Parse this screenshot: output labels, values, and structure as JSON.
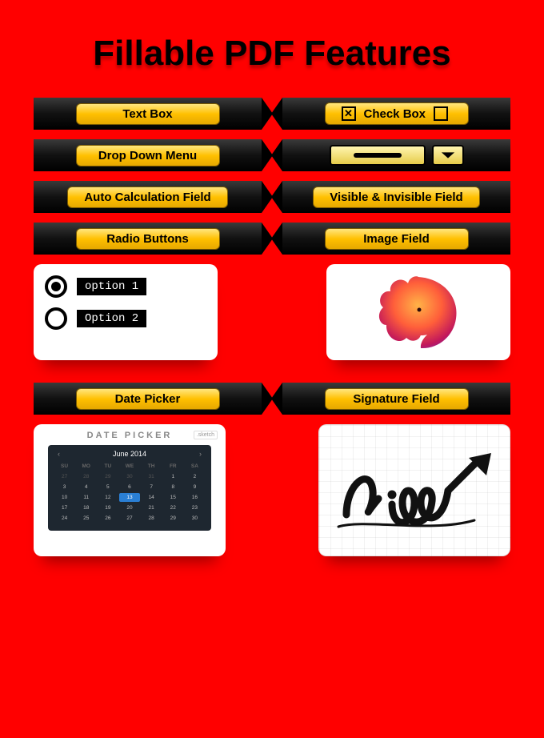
{
  "title": "Fillable PDF Features",
  "features": {
    "text_box": "Text Box",
    "check_box": "Check Box",
    "drop_down": "Drop Down Menu",
    "auto_calc": "Auto Calculation Field",
    "vis_invis": "Visible & Invisible Field",
    "radio": "Radio Buttons",
    "image_field": "Image Field",
    "date_picker": "Date Picker",
    "signature": "Signature Field"
  },
  "radio_options": {
    "opt1": "option 1",
    "opt2": "Option 2"
  },
  "datepicker": {
    "brand": "DATE PICKER",
    "badge": ".sketch",
    "month": "June 2014",
    "headers": [
      "SU",
      "MO",
      "TU",
      "WE",
      "TH",
      "FR",
      "SA"
    ],
    "grid": [
      {
        "v": "27",
        "dim": true
      },
      {
        "v": "28",
        "dim": true
      },
      {
        "v": "29",
        "dim": true
      },
      {
        "v": "30",
        "dim": true
      },
      {
        "v": "31",
        "dim": true
      },
      {
        "v": "1"
      },
      {
        "v": "2"
      },
      {
        "v": "3"
      },
      {
        "v": "4"
      },
      {
        "v": "5"
      },
      {
        "v": "6"
      },
      {
        "v": "7"
      },
      {
        "v": "8"
      },
      {
        "v": "9"
      },
      {
        "v": "10"
      },
      {
        "v": "11"
      },
      {
        "v": "12"
      },
      {
        "v": "13",
        "sel": true
      },
      {
        "v": "14"
      },
      {
        "v": "15"
      },
      {
        "v": "16"
      },
      {
        "v": "17"
      },
      {
        "v": "18"
      },
      {
        "v": "19"
      },
      {
        "v": "20"
      },
      {
        "v": "21"
      },
      {
        "v": "22"
      },
      {
        "v": "23"
      },
      {
        "v": "24"
      },
      {
        "v": "25"
      },
      {
        "v": "26"
      },
      {
        "v": "27"
      },
      {
        "v": "28"
      },
      {
        "v": "29"
      },
      {
        "v": "30"
      }
    ]
  },
  "signature_text": "Sign"
}
